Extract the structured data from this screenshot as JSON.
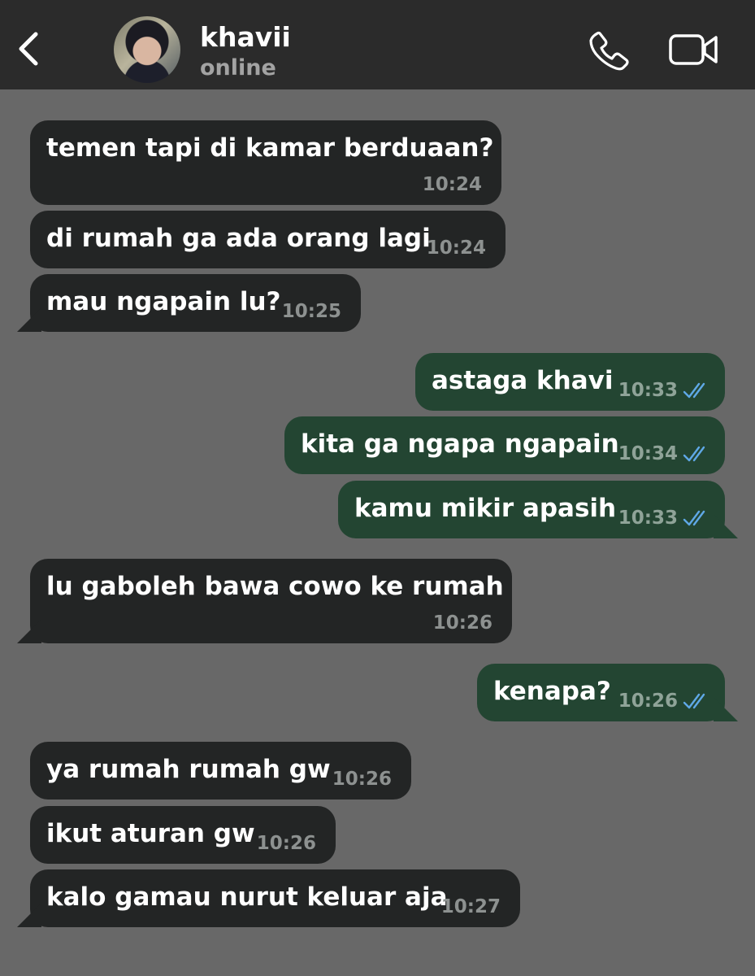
{
  "header": {
    "contact_name": "khavii",
    "status": "online",
    "icons": {
      "back": "chevron-left-icon",
      "call": "phone-icon",
      "video": "video-camera-icon"
    }
  },
  "colors": {
    "background": "#686868",
    "header_bg": "#2b2b2b",
    "incoming_bubble": "#232525",
    "outgoing_bubble": "#234532",
    "read_ticks": "#5fa8e6"
  },
  "messages": [
    {
      "direction": "in",
      "text": "temen tapi di kamar berduaan?",
      "time": "10:24"
    },
    {
      "direction": "in",
      "text": "di rumah ga ada orang lagi",
      "time": "10:24"
    },
    {
      "direction": "in",
      "text": "mau ngapain lu?",
      "time": "10:25"
    },
    {
      "direction": "out",
      "text": "astaga khavi",
      "time": "10:33",
      "status": "read"
    },
    {
      "direction": "out",
      "text": "kita ga ngapa ngapain",
      "time": "10:34",
      "status": "read"
    },
    {
      "direction": "out",
      "text": "kamu mikir apasih",
      "time": "10:33",
      "status": "read"
    },
    {
      "direction": "in",
      "text": "lu gaboleh bawa cowo ke rumah",
      "time": "10:26"
    },
    {
      "direction": "out",
      "text": "kenapa?",
      "time": "10:26",
      "status": "read"
    },
    {
      "direction": "in",
      "text": "ya rumah rumah gw",
      "time": "10:26"
    },
    {
      "direction": "in",
      "text": "ikut aturan gw",
      "time": "10:26"
    },
    {
      "direction": "in",
      "text": "kalo gamau nurut keluar aja",
      "time": "10:27"
    }
  ]
}
